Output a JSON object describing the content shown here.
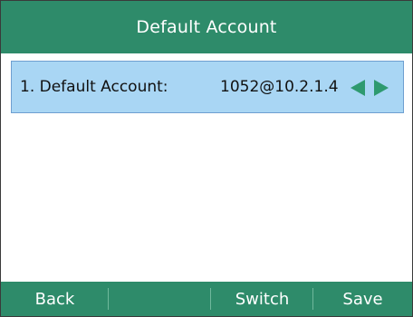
{
  "title": "Default Account",
  "setting": {
    "label": "1. Default Account:",
    "value": "1052@10.2.1.4"
  },
  "softkeys": [
    "Back",
    "",
    "Switch",
    "Save"
  ],
  "icons": {
    "left": "arrow-left-icon",
    "right": "arrow-right-icon"
  },
  "colors": {
    "bar": "#2e8b6a",
    "selection": "#a9d6f4",
    "arrow": "#2e9a6f"
  }
}
